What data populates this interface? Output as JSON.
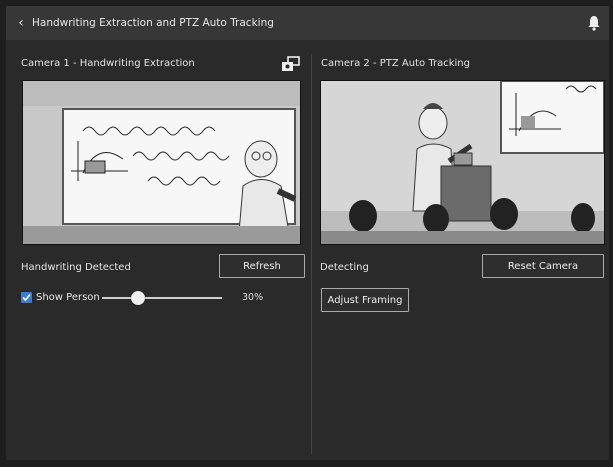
{
  "window": {
    "title": "Handwriting Extraction and PTZ Auto Tracking"
  },
  "icons": {
    "back": "chevron-left-icon",
    "bell": "bell-icon",
    "camera_switch": "camera-switch-icon",
    "check": "check-icon"
  },
  "left_panel": {
    "title": "Camera 1 - Handwriting Extraction",
    "status": "Handwriting Detected",
    "refresh_label": "Refresh",
    "show_person_label": "Show Person",
    "show_person_checked": true,
    "slider_value_percent": 30,
    "slider_value_text": "30%"
  },
  "right_panel": {
    "title": "Camera 2 - PTZ Auto Tracking",
    "status": "Detecting",
    "reset_label": "Reset Camera",
    "adjust_label": "Adjust Framing"
  },
  "colors": {
    "accent": "#3a7bd5",
    "background": "#2a2a2a",
    "titlebar": "#373737"
  }
}
